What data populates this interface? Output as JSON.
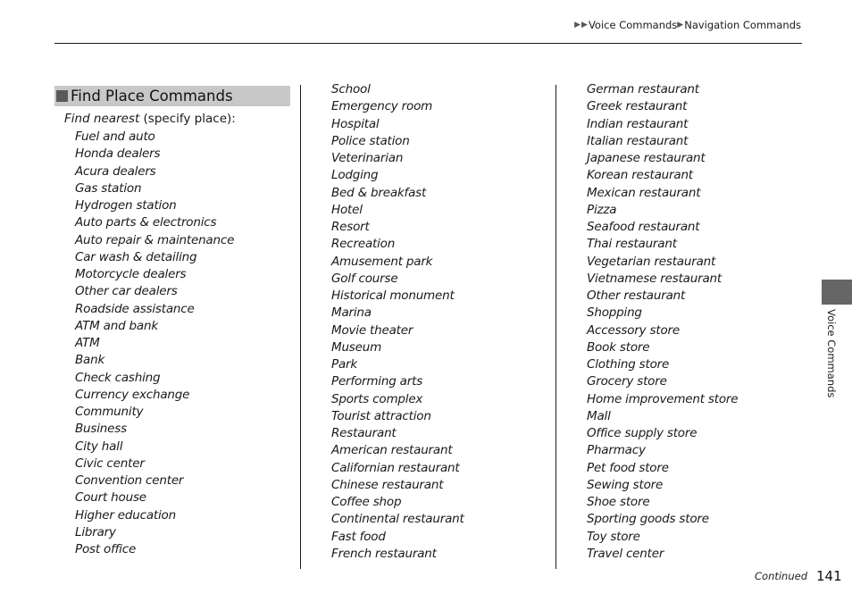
{
  "breadcrumb": {
    "arrow_icon": "right-triangle",
    "items": [
      "Voice Commands",
      "Navigation Commands"
    ]
  },
  "section": {
    "title": "Find Place Commands",
    "lead_italic": "Find nearest",
    "lead_rest": " (specify place):"
  },
  "columns": [
    {
      "items": [
        "Fuel and auto",
        "Honda dealers",
        "Acura dealers",
        "Gas station",
        "Hydrogen station",
        "Auto parts & electronics",
        "Auto repair & maintenance",
        "Car wash & detailing",
        "Motorcycle dealers",
        "Other car dealers",
        "Roadside assistance",
        "ATM and bank",
        "ATM",
        "Bank",
        "Check cashing",
        "Currency exchange",
        "Community",
        "Business",
        "City hall",
        "Civic center",
        "Convention center",
        "Court house",
        "Higher education",
        "Library",
        "Post office"
      ]
    },
    {
      "items": [
        "School",
        "Emergency room",
        "Hospital",
        "Police station",
        "Veterinarian",
        "Lodging",
        "Bed & breakfast",
        "Hotel",
        "Resort",
        "Recreation",
        "Amusement park",
        "Golf course",
        "Historical monument",
        "Marina",
        "Movie theater",
        "Museum",
        "Park",
        "Performing arts",
        "Sports complex",
        "Tourist attraction",
        "Restaurant",
        "American restaurant",
        "Californian restaurant",
        "Chinese restaurant",
        "Coffee shop",
        "Continental restaurant",
        "Fast food",
        "French restaurant"
      ]
    },
    {
      "items": [
        "German restaurant",
        "Greek restaurant",
        "Indian restaurant",
        "Italian restaurant",
        "Japanese restaurant",
        "Korean restaurant",
        "Mexican restaurant",
        "Pizza",
        "Seafood restaurant",
        "Thai restaurant",
        "Vegetarian restaurant",
        "Vietnamese restaurant",
        "Other restaurant",
        "Shopping",
        "Accessory store",
        "Book store",
        "Clothing store",
        "Grocery store",
        "Home improvement store",
        "Mall",
        "Office supply store",
        "Pharmacy",
        "Pet food store",
        "Sewing store",
        "Shoe store",
        "Sporting goods store",
        "Toy store",
        "Travel center"
      ]
    }
  ],
  "side_tab": {
    "label": "Voice Commands"
  },
  "footer": {
    "continued": "Continued",
    "page_number": "141"
  }
}
